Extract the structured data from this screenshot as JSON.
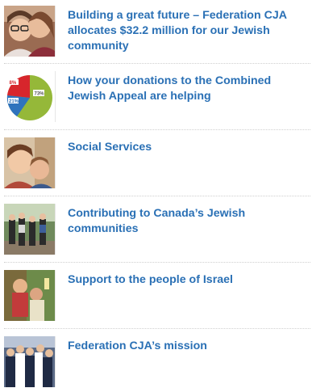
{
  "articles": [
    {
      "title": "Building a great future – Federation CJA allocates $32.2 million for our Jewish community",
      "thumb_icon": "family-photo-icon"
    },
    {
      "title": "How your donations to the Combined Jewish Appeal are helping",
      "thumb_icon": "pie-chart-icon",
      "pie": {
        "labels": [
          "8%",
          "21%",
          "73%"
        ],
        "colors": [
          "#d7262c",
          "#2f73bd",
          "#95b839"
        ]
      }
    },
    {
      "title": "Social Services",
      "thumb_icon": "children-photo-icon"
    },
    {
      "title": "Contributing to Canada’s Jewish communities",
      "thumb_icon": "group-photo-icon"
    },
    {
      "title": "Support to the people of Israel",
      "thumb_icon": "israel-photo-icon"
    },
    {
      "title": "Federation CJA’s mission",
      "thumb_icon": "crowd-photo-icon"
    }
  ]
}
